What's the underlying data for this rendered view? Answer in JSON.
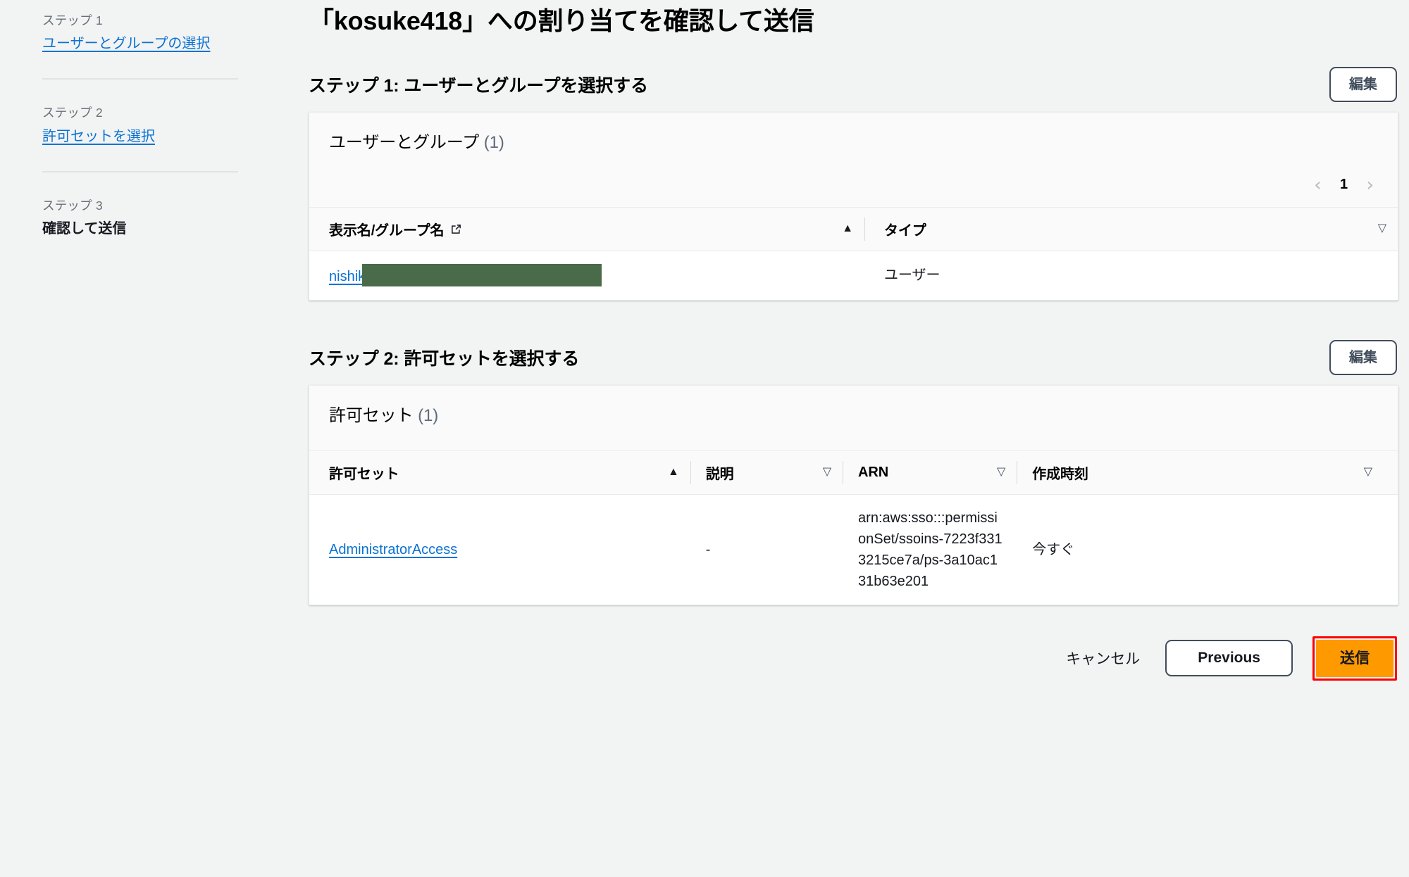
{
  "sidebar": {
    "steps": [
      {
        "step_label": "ステップ 1",
        "name": "ユーザーとグループの選択",
        "state": "link"
      },
      {
        "step_label": "ステップ 2",
        "name": "許可セットを選択",
        "state": "link"
      },
      {
        "step_label": "ステップ 3",
        "name": "確認して送信",
        "state": "current"
      }
    ]
  },
  "main": {
    "page_title": "「kosuke418」への割り当てを確認して送信",
    "edit_label": "編集"
  },
  "step1": {
    "heading": "ステップ 1: ユーザーとグループを選択する",
    "card_title": "ユーザーとグループ",
    "card_count": "(1)",
    "pagination": {
      "prev": "‹",
      "page": "1",
      "next": "›"
    },
    "columns": [
      {
        "label": "表示名/グループ名",
        "icon": "external-link-icon",
        "sort": "▲",
        "sort_state": "asc"
      },
      {
        "label": "タイプ",
        "sort": "▽",
        "sort_state": "none"
      }
    ],
    "rows": [
      {
        "name_visible": "nishik",
        "name_redacted": true,
        "type": "ユーザー"
      }
    ]
  },
  "step2": {
    "heading": "ステップ 2: 許可セットを選択する",
    "card_title": "許可セット",
    "card_count": "(1)",
    "columns": [
      {
        "label": "許可セット",
        "sort": "▲",
        "sort_state": "asc"
      },
      {
        "label": "説明",
        "sort": "▽",
        "sort_state": "none"
      },
      {
        "label": "ARN",
        "sort": "▽",
        "sort_state": "none"
      },
      {
        "label": "作成時刻",
        "sort": "▽",
        "sort_state": "none"
      }
    ],
    "rows": [
      {
        "permission_set": "AdministratorAccess",
        "description": "-",
        "arn": "arn:aws:sso:::permissionSet/ssoins-7223f3313215ce7a/ps-3a10ac131b63e201",
        "created": "今すぐ"
      }
    ]
  },
  "footer": {
    "cancel": "キャンセル",
    "previous": "Previous",
    "submit": "送信"
  },
  "colors": {
    "page_background": "#f2f3f3",
    "link": "#0972d3",
    "primary_button": "#ff9900",
    "highlight_ring": "#ff0000",
    "redaction": "#4a6b49",
    "secondary_border": "#414d5c"
  }
}
